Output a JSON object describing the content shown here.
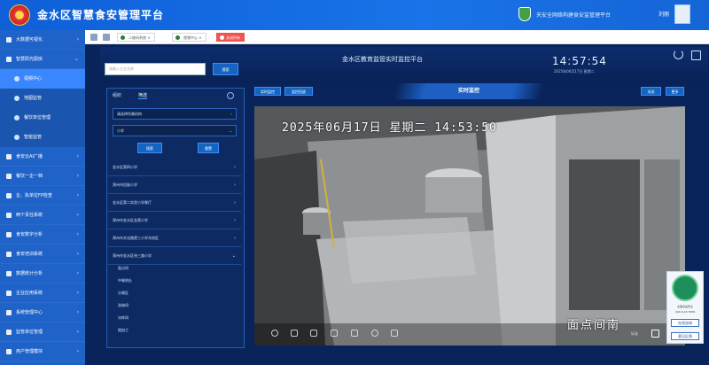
{
  "header": {
    "title": "金水区智慧食安管理平台",
    "platform_name": "天安全网络构建食安监管理平台",
    "user_name": "刘丽"
  },
  "sidebar": {
    "items": [
      {
        "label": "大数据可视化",
        "chev": "›"
      },
      {
        "label": "智慧阳光厨房",
        "chev": "⌄"
      },
      {
        "label": "视频中心",
        "sub": true,
        "active": true
      },
      {
        "label": "地图监管",
        "sub": true
      },
      {
        "label": "餐饮单位管理",
        "sub": true
      },
      {
        "label": "智能监管",
        "sub": true
      },
      {
        "label": "食安云AI广播",
        "chev": "›"
      },
      {
        "label": "餐饮一企一档",
        "chev": "›"
      },
      {
        "label": "企、执单位FP检查",
        "chev": "›"
      },
      {
        "label": "两个责任系统",
        "chev": "›"
      },
      {
        "label": "食安数字分析",
        "chev": "›"
      },
      {
        "label": "食安培训系统",
        "chev": "›"
      },
      {
        "label": "数据统计分析",
        "chev": "›"
      },
      {
        "label": "企业应用系统",
        "chev": "›"
      },
      {
        "label": "系统管理中心",
        "chev": "›"
      },
      {
        "label": "监管单位管理",
        "chev": "›"
      },
      {
        "label": "用户管理模块",
        "chev": "›"
      }
    ]
  },
  "tabs": [
    {
      "label": "二维码系统"
    },
    {
      "label": "视频中心"
    },
    {
      "label": "关闭所有"
    }
  ],
  "panel": {
    "title": "金水区教育监管实时监控平台",
    "time": "14:57:54",
    "date": "2025年06月17日 星期二",
    "search_placeholder": "请输入企业名称",
    "search_button": "搜索"
  },
  "left_panel": {
    "tab_org": "组织",
    "tab_filter": "筛选",
    "select_org": "请选择所属机构",
    "select_type": "小学",
    "search_btn": "搜索",
    "reset_btn": "重置",
    "orgs": [
      "金水区第四小学",
      "郑州市回族小学",
      "金水区第二实验小学餐厅",
      "郑州市金水区金燕小学",
      "郑州市文化路第三小学东校区",
      "郑州市金水区纬三路小学"
    ],
    "children": [
      "面点间",
      "中餐热灶",
      "分餐区",
      "洗碗间",
      "冰库间",
      "粗加工"
    ]
  },
  "video_toolbar": {
    "btn_live": "实时监控",
    "btn_playback": "监控回放",
    "live_label": "实时监控",
    "btn_close": "关闭",
    "btn_more": "更多"
  },
  "video": {
    "osd_date": "2025年06月17日 星期二 14:53:50",
    "osd_name": "面点间南",
    "osd_sub": "标准"
  },
  "badge": {
    "line1": "全国食品安全",
    "line2": "400-6,18.7858",
    "btn1": "在线咨询",
    "btn2": "意见反馈"
  }
}
